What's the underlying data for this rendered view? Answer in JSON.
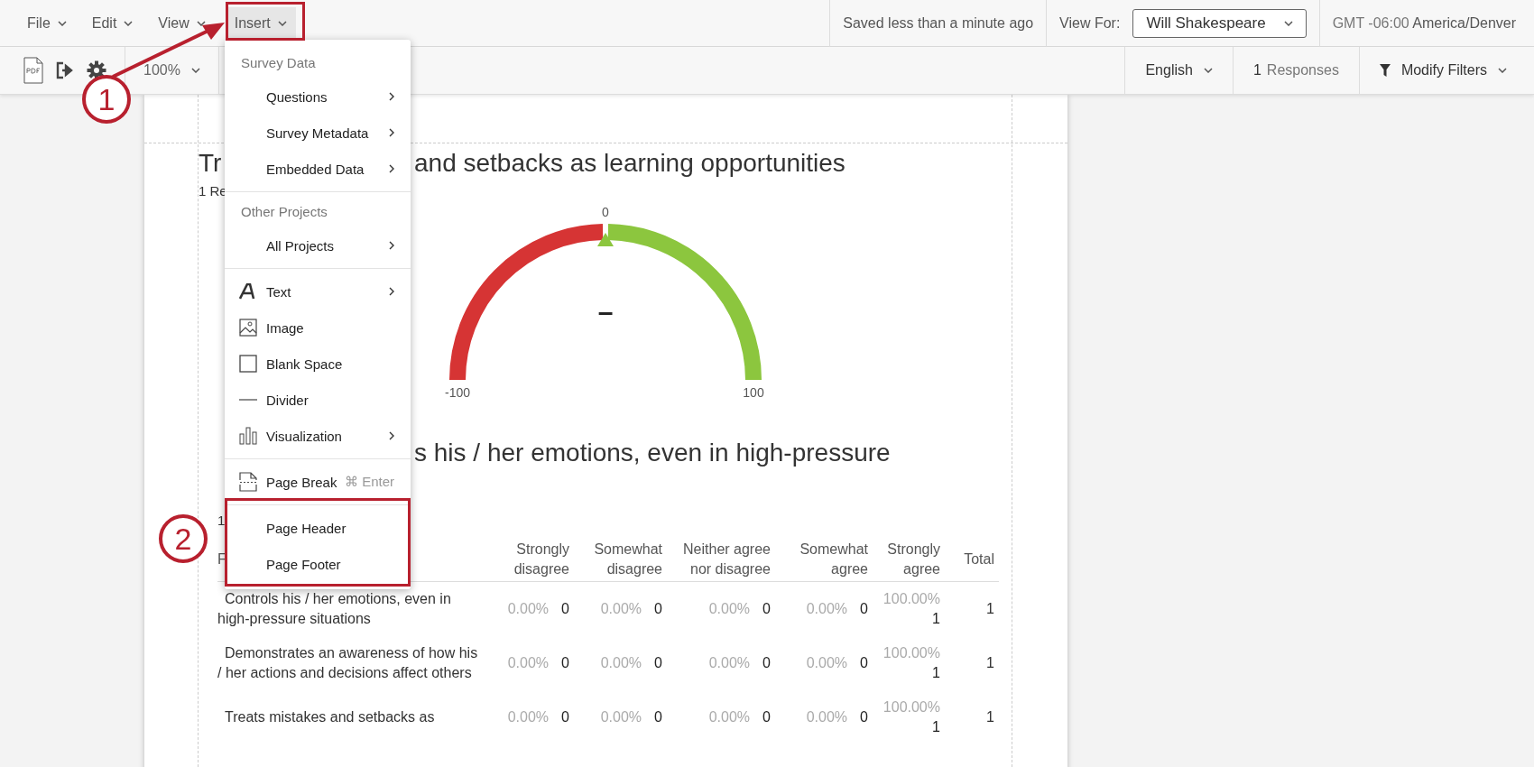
{
  "menubar": [
    {
      "label": "File",
      "selected": false
    },
    {
      "label": "Edit",
      "selected": false
    },
    {
      "label": "View",
      "selected": false
    },
    {
      "label": "Insert",
      "selected": true
    }
  ],
  "save_status": "Saved less than a minute ago",
  "view_for": {
    "label": "View For:",
    "value": "Will Shakespeare"
  },
  "timezone": {
    "offset": "GMT -06:00",
    "name": "America/Denver"
  },
  "toolbar": {
    "zoom": "100%",
    "language": "English",
    "responses_count": "1",
    "responses_label": "Responses",
    "filters": "Modify Filters"
  },
  "insert_menu": [
    {
      "title": "Survey Data",
      "items": [
        {
          "label": "Questions",
          "kind": "plain",
          "submenu": true
        },
        {
          "label": "Survey Metadata",
          "kind": "plain",
          "submenu": true
        },
        {
          "label": "Embedded Data",
          "kind": "plain",
          "submenu": true
        }
      ]
    },
    {
      "title": "Other Projects",
      "items": [
        {
          "label": "All Projects",
          "kind": "plain",
          "submenu": true
        }
      ]
    },
    {
      "items": [
        {
          "label": "Text",
          "kind": "text",
          "submenu": true
        },
        {
          "label": "Image",
          "kind": "image",
          "submenu": false
        },
        {
          "label": "Blank Space",
          "kind": "blank",
          "submenu": false
        },
        {
          "label": "Divider",
          "kind": "divider",
          "submenu": false
        },
        {
          "label": "Visualization",
          "kind": "visualization",
          "submenu": true
        }
      ]
    },
    {
      "items": [
        {
          "label": "Page Break",
          "kind": "page-break",
          "submenu": false,
          "shortcut": "⌘ Enter"
        }
      ]
    },
    {
      "items": [
        {
          "label": "Page Header",
          "kind": "plain",
          "submenu": false
        },
        {
          "label": "Page Footer",
          "kind": "plain",
          "submenu": false
        }
      ]
    }
  ],
  "annotations": [
    {
      "label": "1"
    },
    {
      "label": "2"
    }
  ],
  "question_1": {
    "title_start": "Tr",
    "title_end": "and setbacks as learning opportunities",
    "subtitle": "1 Re",
    "gauge": {
      "min": "-100",
      "mid": "0",
      "max": "100",
      "value": "–"
    }
  },
  "question_2": {
    "title_end": "s his / her emotions, even in high-pressure",
    "subtitle": "1",
    "table": {
      "label_column": "F",
      "columns": [
        "Strongly disagree",
        "Somewhat disagree",
        "Neither agree nor disagree",
        "Somewhat agree",
        "Strongly agree",
        "Total"
      ],
      "rows": [
        {
          "label": "Controls his / her emotions, even in high-pressure situations",
          "cells": [
            {
              "pct": "0.00%",
              "count": "0"
            },
            {
              "pct": "0.00%",
              "count": "0"
            },
            {
              "pct": "0.00%",
              "count": "0"
            },
            {
              "pct": "0.00%",
              "count": "0"
            },
            {
              "pct": "100.00%",
              "count": "1"
            },
            {
              "count": "1"
            }
          ]
        },
        {
          "label": "Demonstrates an awareness of how his / her actions and decisions affect others",
          "cells": [
            {
              "pct": "0.00%",
              "count": "0"
            },
            {
              "pct": "0.00%",
              "count": "0"
            },
            {
              "pct": "0.00%",
              "count": "0"
            },
            {
              "pct": "0.00%",
              "count": "0"
            },
            {
              "pct": "100.00%",
              "count": "1"
            },
            {
              "count": "1"
            }
          ]
        },
        {
          "label": "Treats mistakes and setbacks as",
          "cells": [
            {
              "pct": "0.00%",
              "count": "0"
            },
            {
              "pct": "0.00%",
              "count": "0"
            },
            {
              "pct": "0.00%",
              "count": "0"
            },
            {
              "pct": "0.00%",
              "count": "0"
            },
            {
              "pct": "100.00%",
              "count": "1"
            },
            {
              "count": "1"
            }
          ]
        }
      ]
    }
  }
}
